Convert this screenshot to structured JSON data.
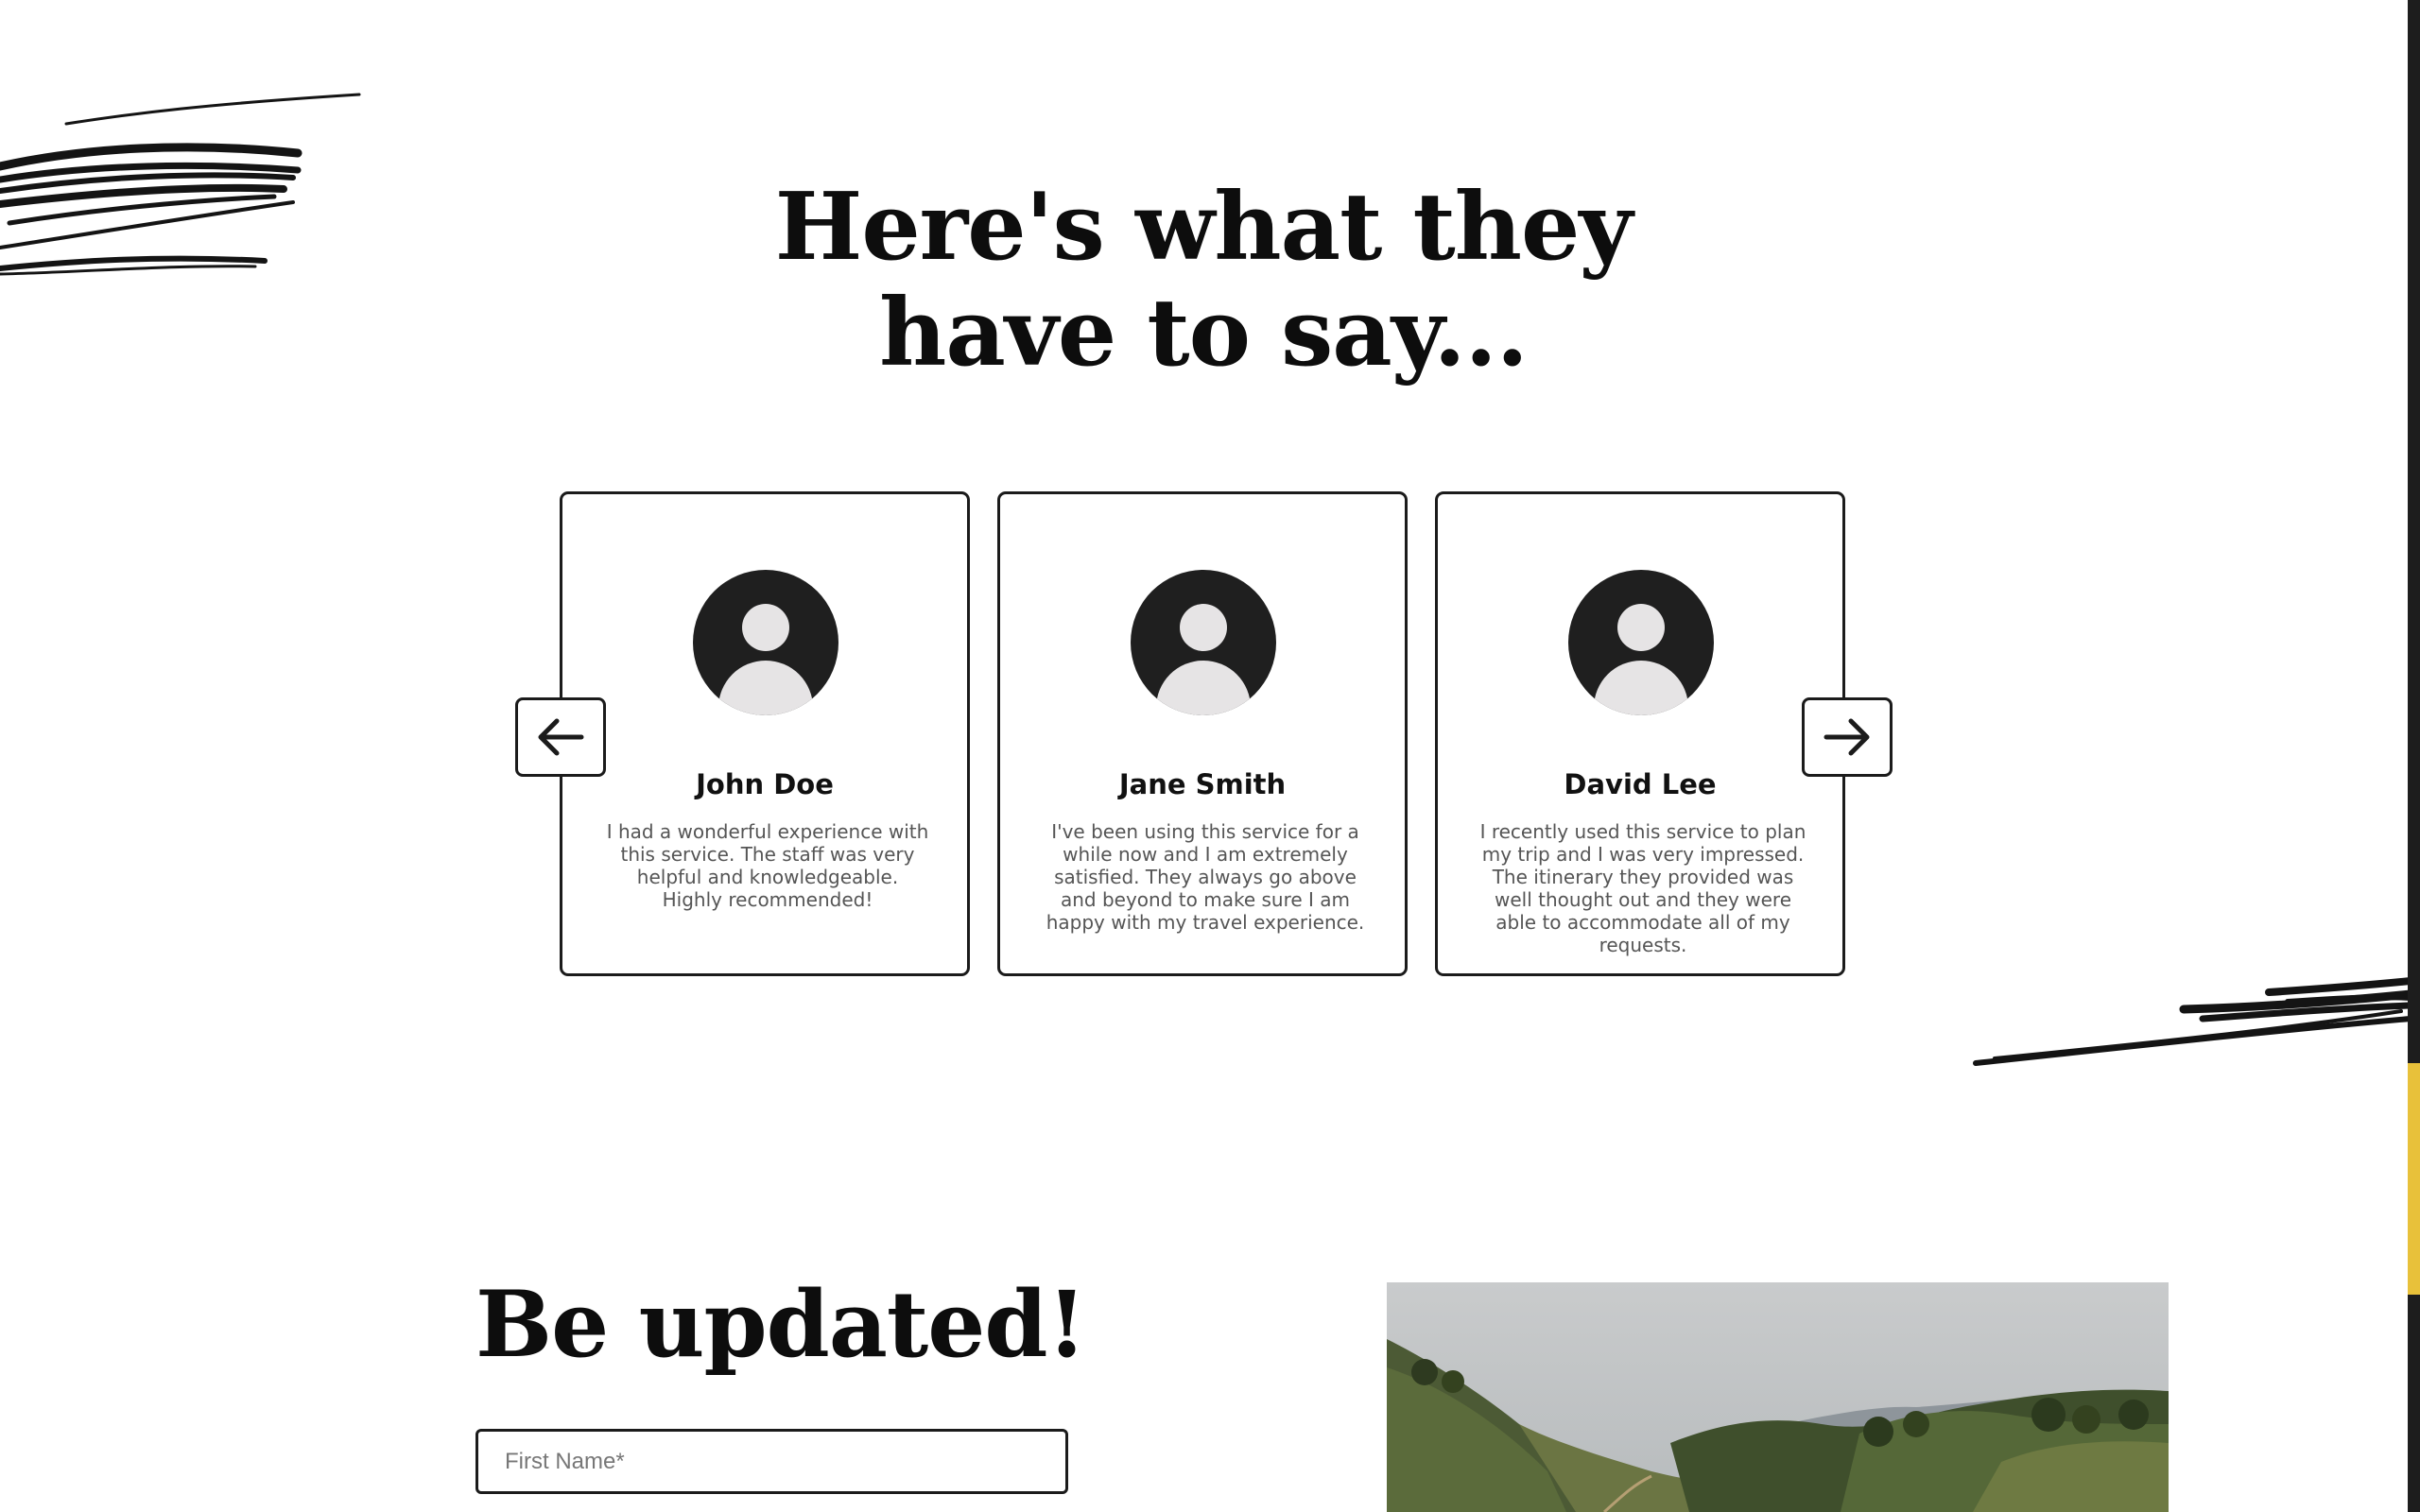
{
  "testimonials_section": {
    "heading_line1": "Here's what they",
    "heading_line2": "have to say...",
    "items": [
      {
        "name": "John Doe",
        "quote": "I had a wonderful experience with this service. The staff was very helpful and knowledgeable. Highly recommended!"
      },
      {
        "name": "Jane Smith",
        "quote": "I've been using this service for a while now and I am extremely satisfied. They always go above and beyond to make sure I am happy with my travel experience."
      },
      {
        "name": "David Lee",
        "quote": "I recently used this service to plan my trip and I was very impressed. The itinerary they provided was well thought out and they were able to accommodate all of my requests."
      }
    ],
    "prev_icon": "arrow-left-icon",
    "next_icon": "arrow-right-icon"
  },
  "newsletter": {
    "heading": "Be updated!",
    "first_name_placeholder": "First Name*"
  },
  "colors": {
    "text": "#0d0d0d",
    "border": "#1b1b1b",
    "quote_text": "#555555",
    "scrollbar_track": "#1d1d1d",
    "scrollbar_thumb": "#e8c13a"
  }
}
